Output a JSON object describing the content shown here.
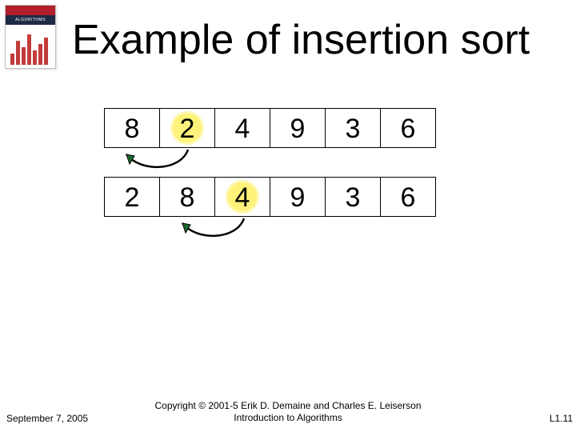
{
  "title": "Example of insertion sort",
  "book_label": "ALGORITHMS",
  "rows": [
    {
      "values": [
        "8",
        "2",
        "4",
        "9",
        "3",
        "6"
      ],
      "highlight_index": 1
    },
    {
      "values": [
        "2",
        "8",
        "4",
        "9",
        "3",
        "6"
      ],
      "highlight_index": 2
    }
  ],
  "footer": {
    "date": "September 7, 2005",
    "copyright_line1": "Copyright © 2001-5 Erik D. Demaine and Charles E. Leiserson",
    "copyright_line2": "Introduction to Algorithms",
    "page": "L1.11"
  },
  "colors": {
    "highlight": "#fff27a",
    "arrow": "#000000",
    "arrowhead_fill": "#1a6b2e"
  }
}
